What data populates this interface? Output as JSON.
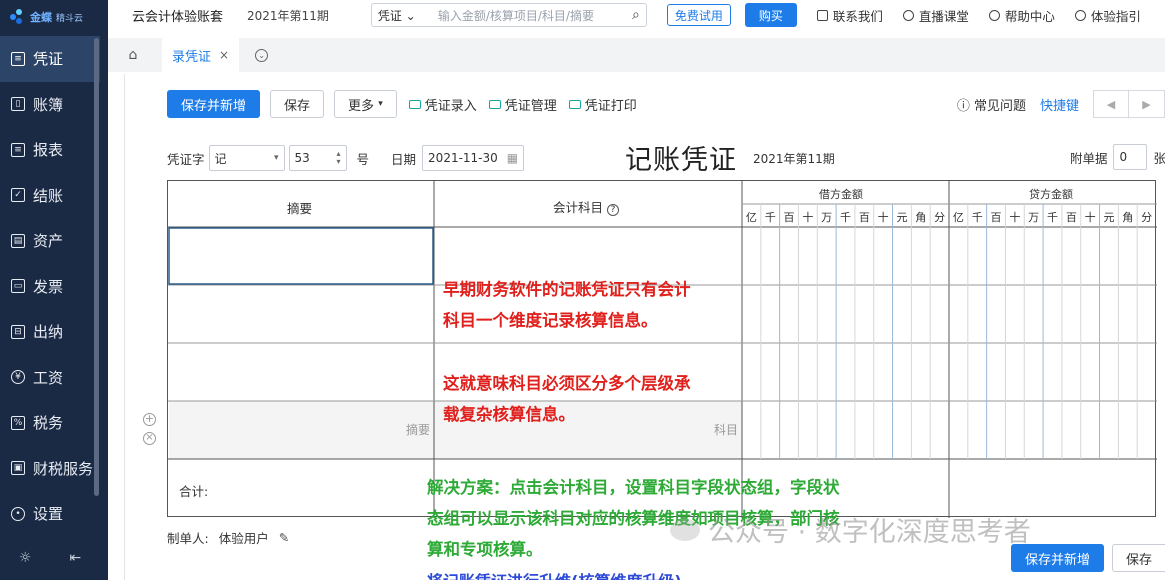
{
  "brand": {
    "name": "金蝶",
    "sub": "精斗云"
  },
  "header": {
    "app_name": "云会计体验账套",
    "period": "2021年第11期",
    "search_select": "凭证",
    "search_placeholder": "输入金额/核算项目/科目/摘要",
    "trial_label": "免费试用",
    "buy_label": "购买",
    "links": [
      "联系我们",
      "直播课堂",
      "帮助中心",
      "体验指引"
    ]
  },
  "sidebar": {
    "items": [
      {
        "label": "凭证",
        "active": true
      },
      {
        "label": "账簿"
      },
      {
        "label": "报表"
      },
      {
        "label": "结账"
      },
      {
        "label": "资产"
      },
      {
        "label": "发票"
      },
      {
        "label": "出纳"
      },
      {
        "label": "工资"
      },
      {
        "label": "税务"
      },
      {
        "label": "财税服务"
      },
      {
        "label": "设置"
      }
    ]
  },
  "tabs": [
    {
      "label": "录凭证"
    }
  ],
  "toolbar": {
    "save_new": "保存并新增",
    "save": "保存",
    "more": "更多",
    "links": [
      "凭证录入",
      "凭证管理",
      "凭证打印"
    ],
    "faq": "常见问题",
    "shortcut": "快捷键"
  },
  "voucher": {
    "word_label": "凭证字",
    "word_value": "记",
    "number": "53",
    "number_suffix": "号",
    "date_label": "日期",
    "date_value": "2021-11-30",
    "title": "记账凭证",
    "period": "2021年第11期",
    "attach_label": "附单据",
    "attach_count": "0",
    "attach_unit": "张"
  },
  "table": {
    "col_summary": "摘要",
    "col_account": "会计科目",
    "col_debit": "借方金额",
    "col_credit": "贷方金额",
    "digits": [
      "亿",
      "千",
      "百",
      "十",
      "万",
      "千",
      "百",
      "十",
      "元",
      "角",
      "分"
    ],
    "placeholder_summary": "摘要",
    "placeholder_account": "科目",
    "total_label": "合计:"
  },
  "notes": {
    "red": [
      "早期财务软件的记账凭证只有会计",
      "科目一个维度记录核算信息。",
      "这就意味科目必须区分多个层级承",
      "载复杂核算信息。"
    ],
    "green": [
      "解决方案：点击会计科目，设置科目字段状态组，字段状",
      "态组可以显示该科目对应的核算维度如项目核算，部门核",
      "算和专项核算。"
    ],
    "blue": "将记账凭证进行升维(核算维度升级)"
  },
  "footer": {
    "maker_label": "制单人:",
    "maker_value": "体验用户"
  },
  "bottom": {
    "save_new": "保存并新增",
    "save": "保存"
  },
  "watermark": "公众号 · 数字化深度思考者"
}
